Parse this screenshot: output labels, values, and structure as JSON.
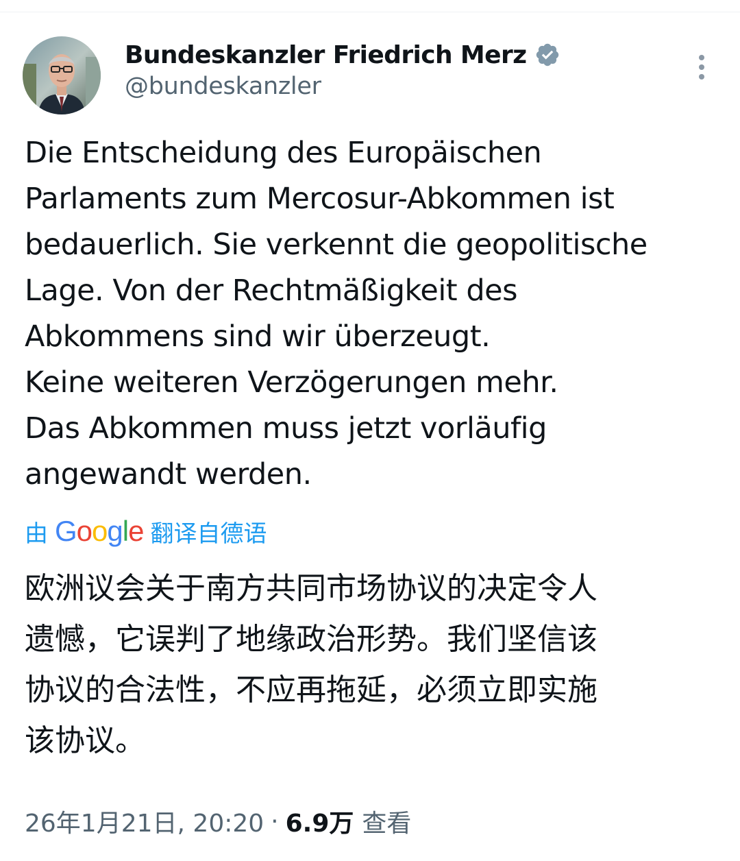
{
  "author": {
    "display_name": "Bundeskanzler Friedrich Merz",
    "handle": "@bundeskanzler",
    "verified": true,
    "verified_color": "#829aab"
  },
  "icons": {
    "verified": "verified-badge-icon",
    "more": "more-vertical-icon",
    "avatar": "profile-photo"
  },
  "tweet": {
    "text_lines": [
      "Die Entscheidung des Europäischen",
      "Parlaments zum Mercosur-Abkommen ist",
      "bedauerlich. Sie verkennt die geopolitische",
      "Lage. Von der Rechtmäßigkeit des",
      "Abkommens sind wir überzeugt.",
      "Keine weiteren Verzögerungen mehr.",
      "Das Abkommen muss jetzt vorläufig",
      "angewandt werden."
    ]
  },
  "translation": {
    "prefix": "由",
    "brand": "Google",
    "suffix": "翻译自德语",
    "link_color": "#1d9bf0",
    "translated_lines": [
      "欧洲议会关于南方共同市场协议的决定令人",
      "遗憾，它误判了地缘政治形势。我们坚信该",
      "协议的合法性，不应再拖延，必须立即实施",
      "该协议。"
    ]
  },
  "meta": {
    "timestamp": "26年1月21日, 20:20",
    "separator": "·",
    "views_count": "6.9万",
    "views_label": "查看"
  }
}
